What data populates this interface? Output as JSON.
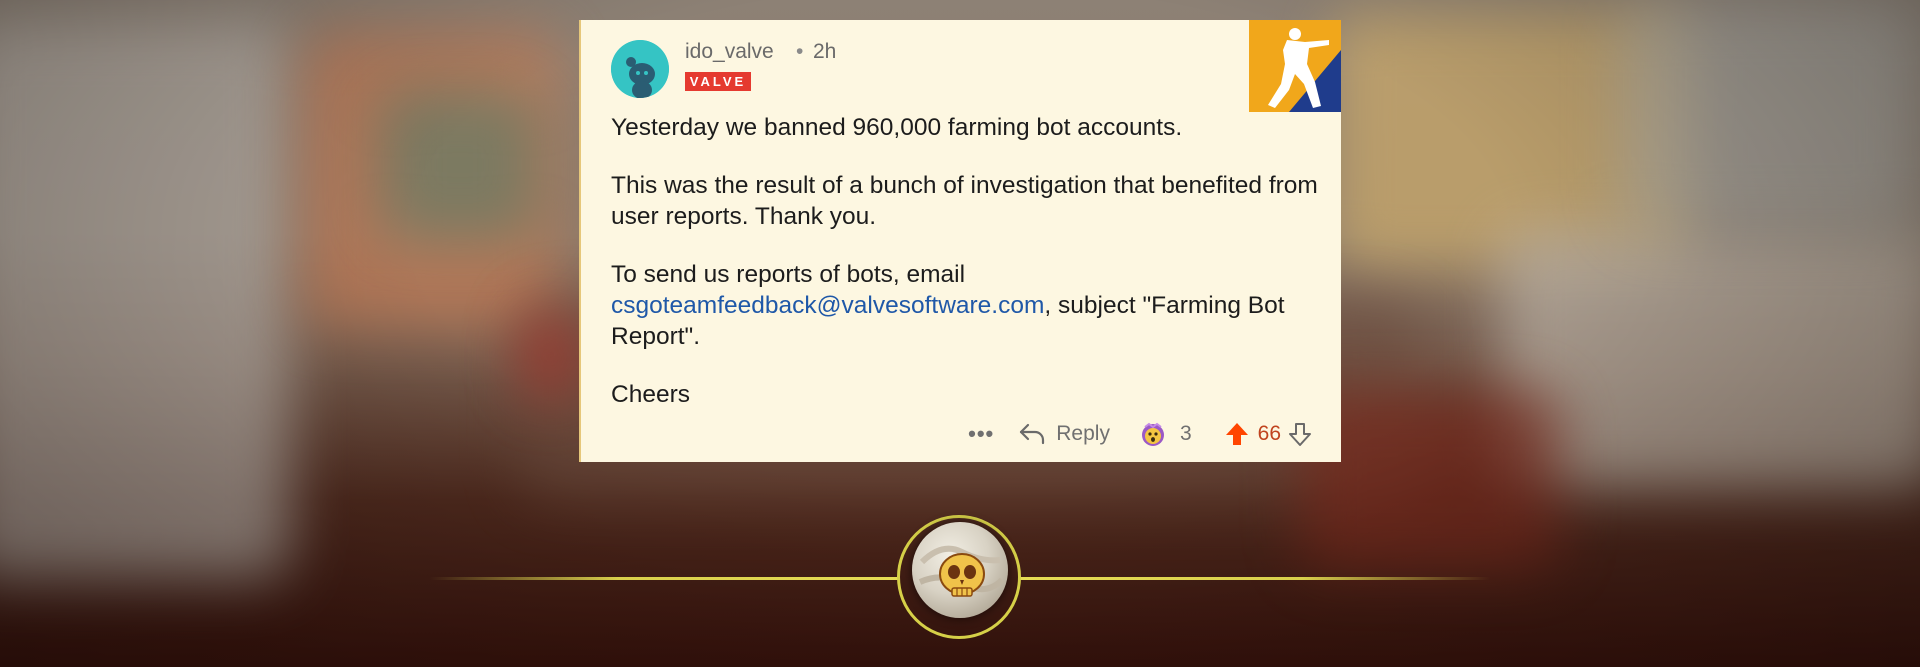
{
  "comment": {
    "username": "ido_valve",
    "separator": "•",
    "time_ago": "2h",
    "flair": "VALVE",
    "paragraphs": {
      "p1": "Yesterday we banned 960,000 farming bot accounts.",
      "p2": "This was the result of a bunch of investigation that benefited from user reports. Thank you.",
      "p3_before": "To send us reports of bots, email ",
      "p3_email": "csgoteamfeedback@valvesoftware.com",
      "p3_after": ", subject \"Farming Bot Report\".",
      "p4": "Cheers"
    },
    "actions": {
      "more": "•••",
      "reply_label": "Reply",
      "award_count": "3",
      "score": "66"
    }
  },
  "colors": {
    "card_background": "#fdf7e1",
    "flair_red": "#e53a2f",
    "link_blue": "#1f58a8",
    "upvote_orange": "#ff4500",
    "avatar_teal": "#35c4c4",
    "logo_gold": "#f1a71b",
    "logo_navy": "#1f3c8c"
  },
  "icons": {
    "avatar": "reddit-snoo-avatar-icon",
    "logo": "counter-strike-logo-icon",
    "reply": "reply-arrow-icon",
    "award": "shocked-face-award-icon",
    "upvote": "upvote-arrow-icon",
    "downvote": "downvote-arrow-icon",
    "medal": "skull-coin-medal-icon"
  }
}
